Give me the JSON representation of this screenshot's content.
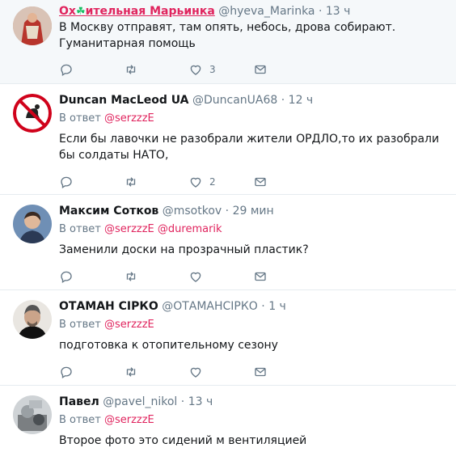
{
  "tweets": [
    {
      "name_pre": "Ох",
      "name_emoji": "☘",
      "name_post": "ительная Марьинка",
      "handle": "@hyeva_Marinka",
      "time": "13 ч",
      "text": "В Москву отправят, там опять, небось, дрова собирают. Гуманитарная помощь",
      "likes": "3"
    },
    {
      "name": "Duncan MacLeod UA",
      "handle": "@DuncanUA68",
      "time": "12 ч",
      "reply_prefix": "В ответ",
      "mention": "@serzzzE",
      "text": "Если бы лавочки не разобрали жители ОРДЛО,то их разобрали бы солдаты НАТО,",
      "likes": "2"
    },
    {
      "name": "Максим Сотков",
      "handle": "@msotkov",
      "time": "29 мин",
      "reply_prefix": "В ответ",
      "mention": "@serzzzE",
      "mention2": "@duremarik",
      "text": "Заменили доски на прозрачный пластик?"
    },
    {
      "name": "ОТАМАН СІРКО",
      "handle": "@ОТАМАНСІРКО",
      "time": "1 ч",
      "reply_prefix": "В ответ",
      "mention": "@serzzzE",
      "text": "подготовка к отопительному сезону"
    },
    {
      "name": "Павел",
      "handle": "@pavel_nikol",
      "time": "13 ч",
      "reply_prefix": "В ответ",
      "mention": "@serzzzE",
      "text": "Второе фото это сидений м вентиляцией"
    }
  ],
  "separator": "·",
  "icons": [
    "reply-icon",
    "retweet-icon",
    "like-icon",
    "direct-message-icon"
  ],
  "colors": {
    "accent": "#e0245e",
    "muted": "#657786",
    "divider": "#e6ecf0"
  }
}
